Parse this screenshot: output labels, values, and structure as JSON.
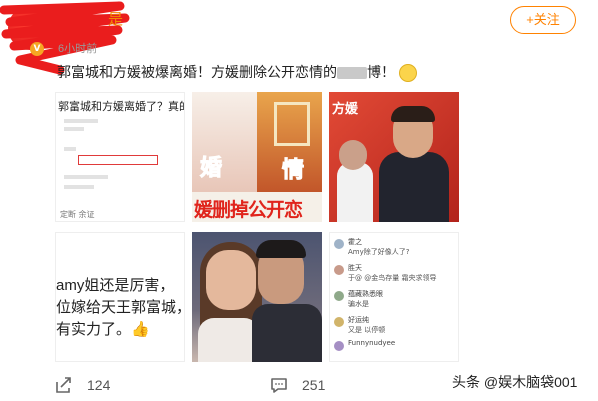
{
  "post": {
    "username_visible": "是",
    "timestamp": "6小时前",
    "follow_label": "+关注",
    "text_before": "郭富城和方媛被爆离婚！方媛删除公开恋情的",
    "text_after": "博！"
  },
  "grid": {
    "tile1": {
      "title": "郭富城和方媛离婚了？真的假的",
      "footer": "定断 余证"
    },
    "tile2": {
      "word_left": "婚",
      "word_right": "情",
      "caption": "媛删掉公开恋"
    },
    "tile3": {
      "label": "方媛"
    },
    "tile4": {
      "lines": [
        "amy姐还是厉害，",
        "位嫁给天王郭富城，",
        "有实力了。👍"
      ]
    },
    "tile6": {
      "comments": [
        {
          "name": "霍之",
          "text": "Amy除了好像人了?"
        },
        {
          "name": "胜天",
          "text": "于@ @金鸟存量 霜央求领导"
        },
        {
          "name": "蕴藏熟悉眼",
          "text": "骗水是"
        },
        {
          "name": "好运纯",
          "text": "又是 以停顿"
        },
        {
          "name": "Funnynudyee",
          "text": ""
        }
      ]
    }
  },
  "footer": {
    "share_count": "124",
    "comment_count": "251"
  },
  "watermark": "头条 @娱木脑袋001",
  "colors": {
    "accent": "#ff8200",
    "highlight": "#e0241c"
  }
}
